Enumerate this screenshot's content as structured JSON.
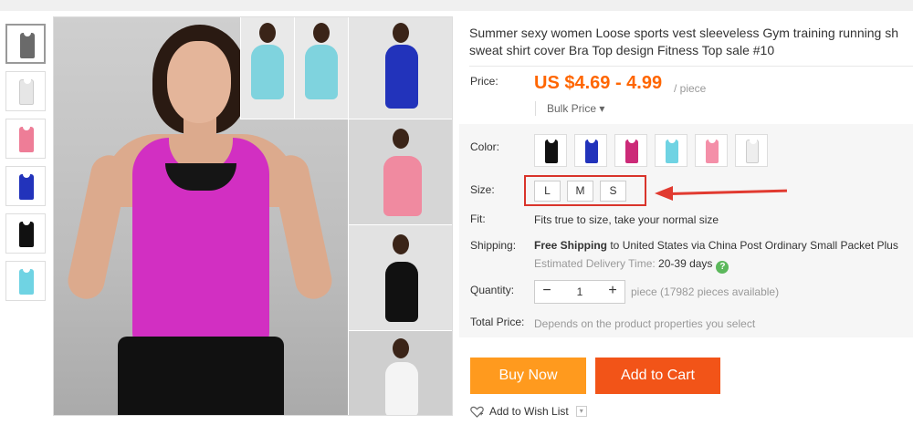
{
  "product": {
    "title_line1": "Summer sexy women Loose sports vest sleeveless Gym training running sh",
    "title_line2": "sweat shirt cover Bra Top design Fitness Top sale #10"
  },
  "price": {
    "label": "Price:",
    "value": "US $4.69 - 4.99",
    "unit": "/ piece",
    "bulk_label": "Bulk Price ▾"
  },
  "color": {
    "label": "Color:",
    "swatches": [
      {
        "name": "black",
        "hex": "#111111"
      },
      {
        "name": "blue",
        "hex": "#2233bb"
      },
      {
        "name": "magenta",
        "hex": "#cc2a78"
      },
      {
        "name": "cyan",
        "hex": "#6fd3e3"
      },
      {
        "name": "pink",
        "hex": "#f48fa8"
      },
      {
        "name": "white",
        "hex": "#eeeeee"
      }
    ]
  },
  "size": {
    "label": "Size:",
    "options": [
      "L",
      "M",
      "S"
    ]
  },
  "fit": {
    "label": "Fit:",
    "text": "Fits true to size, take your normal size"
  },
  "shipping": {
    "label": "Shipping:",
    "free": "Free Shipping",
    "rest": " to United States via China Post Ordinary Small Packet Plus",
    "delivery_label": "Estimated Delivery Time: ",
    "delivery_days": "20-39 days",
    "help_icon": "?"
  },
  "quantity": {
    "label": "Quantity:",
    "minus": "−",
    "value": "1",
    "plus": "+",
    "note": "piece (17982 pieces available)"
  },
  "total": {
    "label": "Total Price:",
    "text": "Depends on the product properties you select"
  },
  "actions": {
    "buy_now": "Buy Now",
    "add_to_cart": "Add to Cart",
    "wish_list": "Add to Wish List",
    "wish_caret": "▾"
  },
  "thumbnails": [
    {
      "name": "collage",
      "hex": "#6a6a6a"
    },
    {
      "name": "white",
      "hex": "#e6e6e6"
    },
    {
      "name": "pink",
      "hex": "#ee7d97"
    },
    {
      "name": "blue",
      "hex": "#2233bb"
    },
    {
      "name": "black",
      "hex": "#111111"
    },
    {
      "name": "cyan",
      "hex": "#6fd3e3"
    }
  ]
}
